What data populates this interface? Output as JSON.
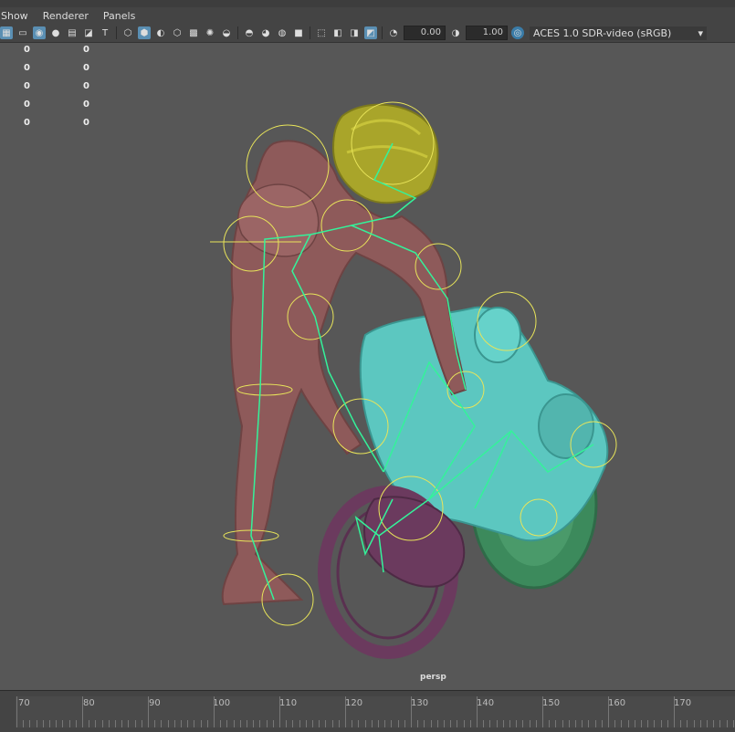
{
  "menu": [
    "Show",
    "Renderer",
    "Panels"
  ],
  "toolbar": {
    "exposure": "0.00",
    "gamma": "1.00",
    "color_space": "ACES 1.0 SDR-video (sRGB)"
  },
  "hud": {
    "rows": [
      {
        "a": "0",
        "b": "0"
      },
      {
        "a": "0",
        "b": "0"
      },
      {
        "a": "0",
        "b": "0"
      },
      {
        "a": "0",
        "b": "0"
      },
      {
        "a": "0",
        "b": "0"
      }
    ]
  },
  "viewport": {
    "camera": "persp"
  },
  "timeline": {
    "ticks": [
      "70",
      "80",
      "90",
      "100",
      "110",
      "120",
      "130",
      "140",
      "150",
      "160",
      "170"
    ]
  },
  "colors": {
    "character": "#8e5a5a",
    "helmet": "#a9a52a",
    "bike_front": "#5cc7c0",
    "bike_wheel_rear": "#3c8a5c",
    "bike_wheel_front": "#6b3a5e",
    "joints": "#34f29a",
    "controls": "#e8e45a"
  }
}
